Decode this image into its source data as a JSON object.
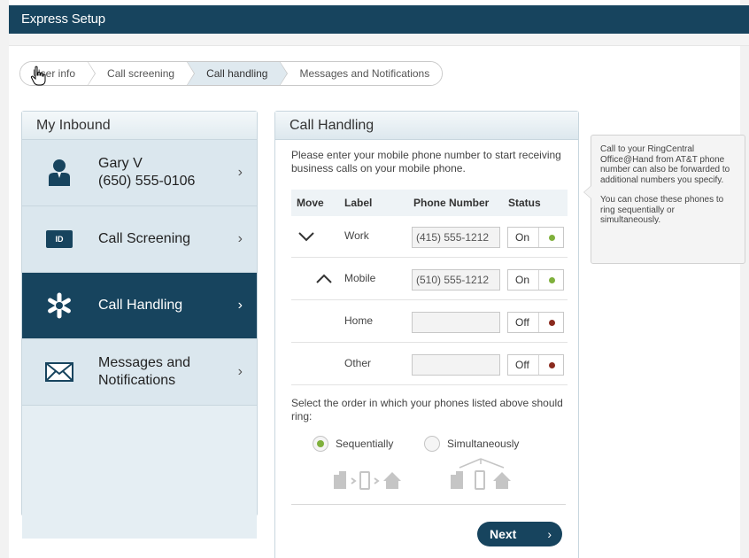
{
  "header": {
    "title": "Express Setup"
  },
  "breadcrumb": [
    "User info",
    "Call screening",
    "Call handling",
    "Messages and Notifications"
  ],
  "sidebar": {
    "title": "My Inbound",
    "user": {
      "name": "Gary V",
      "phone": "(650) 555-0106"
    },
    "items": [
      {
        "label": "Call Screening",
        "icon": "id-badge-icon"
      },
      {
        "label": "Call Handling",
        "icon": "asterisk-icon",
        "active": true
      },
      {
        "label1": "Messages and",
        "label2": "Notifications",
        "icon": "envelope-icon"
      }
    ],
    "chevron": "›"
  },
  "panel": {
    "title": "Call Handling",
    "intro": "Please enter your mobile phone number to start receiving business calls on your mobile phone.",
    "columns": {
      "move": "Move",
      "label": "Label",
      "phone": "Phone Number",
      "status": "Status"
    },
    "rows": [
      {
        "label": "Work",
        "phone": "(415) 555-1212",
        "status": "On",
        "move": "down"
      },
      {
        "label": "Mobile",
        "phone": "(510) 555-1212",
        "status": "On",
        "move": "up"
      },
      {
        "label": "Home",
        "phone": "",
        "status": "Off",
        "move": ""
      },
      {
        "label": "Other",
        "phone": "",
        "status": "Off",
        "move": ""
      }
    ],
    "order_text": "Select the order in which your phones listed above should ring:",
    "order_options": {
      "sequential": "Sequentially",
      "simultaneous": "Simultaneously"
    },
    "order_selected": "Sequentially",
    "next_label": "Next",
    "next_arrow": "›"
  },
  "tooltip": {
    "p1": "Call to your RingCentral Office@Hand from AT&T phone number can also be forwarded to additional numbers you specify.",
    "p2": "You can chose these phones to ring sequentially or simultaneously."
  },
  "colors": {
    "header": "#17445e",
    "on": "#7fb03c",
    "off": "#8a2a1e",
    "active_nav": "#17445e"
  }
}
